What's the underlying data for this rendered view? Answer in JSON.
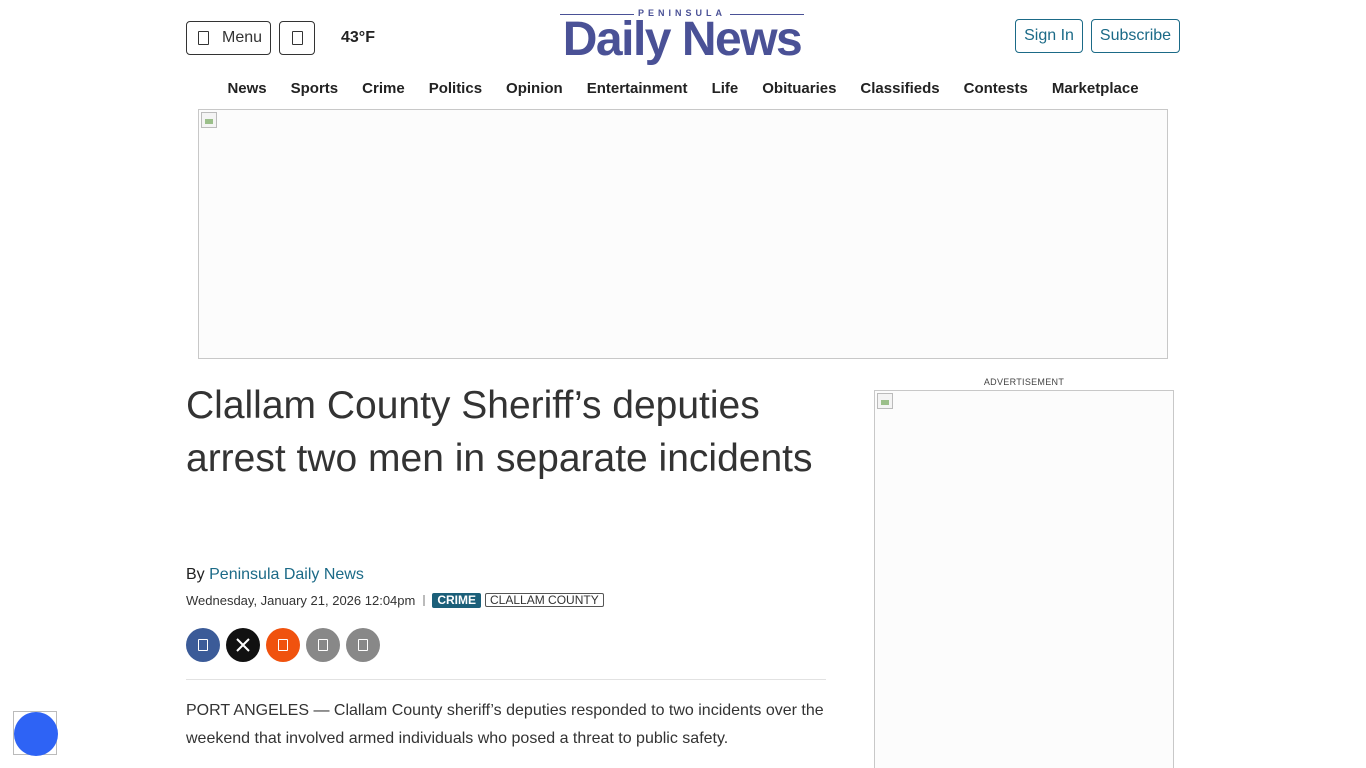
{
  "header": {
    "menu_label": "Menu",
    "weather": "43°F",
    "logo_small": "PENINSULA",
    "logo_big": "Daily News",
    "signin_label": "Sign In",
    "subscribe_label": "Subscribe"
  },
  "nav": {
    "items": [
      "News",
      "Sports",
      "Crime",
      "Politics",
      "Opinion",
      "Entertainment",
      "Life",
      "Obituaries",
      "Classifieds",
      "Contests",
      "Marketplace"
    ]
  },
  "sidebar": {
    "ad_label": "ADVERTISEMENT"
  },
  "article": {
    "headline": "Clallam County Sheriff’s deputies arrest two men in separate incidents",
    "by_prefix": "By",
    "author": "Peninsula Daily News",
    "date": "Wednesday, January 21, 2026 12:04pm",
    "tags": [
      "CRIME",
      "CLALLAM COUNTY"
    ],
    "body_first": "PORT ANGELES — Clallam County sheriff’s deputies responded to two incidents over the weekend that involved armed individuals who posed a threat to public safety."
  },
  "share": {
    "icons": [
      "facebook-icon",
      "x-icon",
      "reddit-icon",
      "email-icon",
      "print-icon"
    ]
  },
  "colors": {
    "brand": "#4a5196",
    "link": "#1b6a87",
    "tag_crime_bg": "#1b5f79",
    "facebook": "#3b5b98",
    "reddit": "#f0520e",
    "a11y": "#2e63f5"
  }
}
